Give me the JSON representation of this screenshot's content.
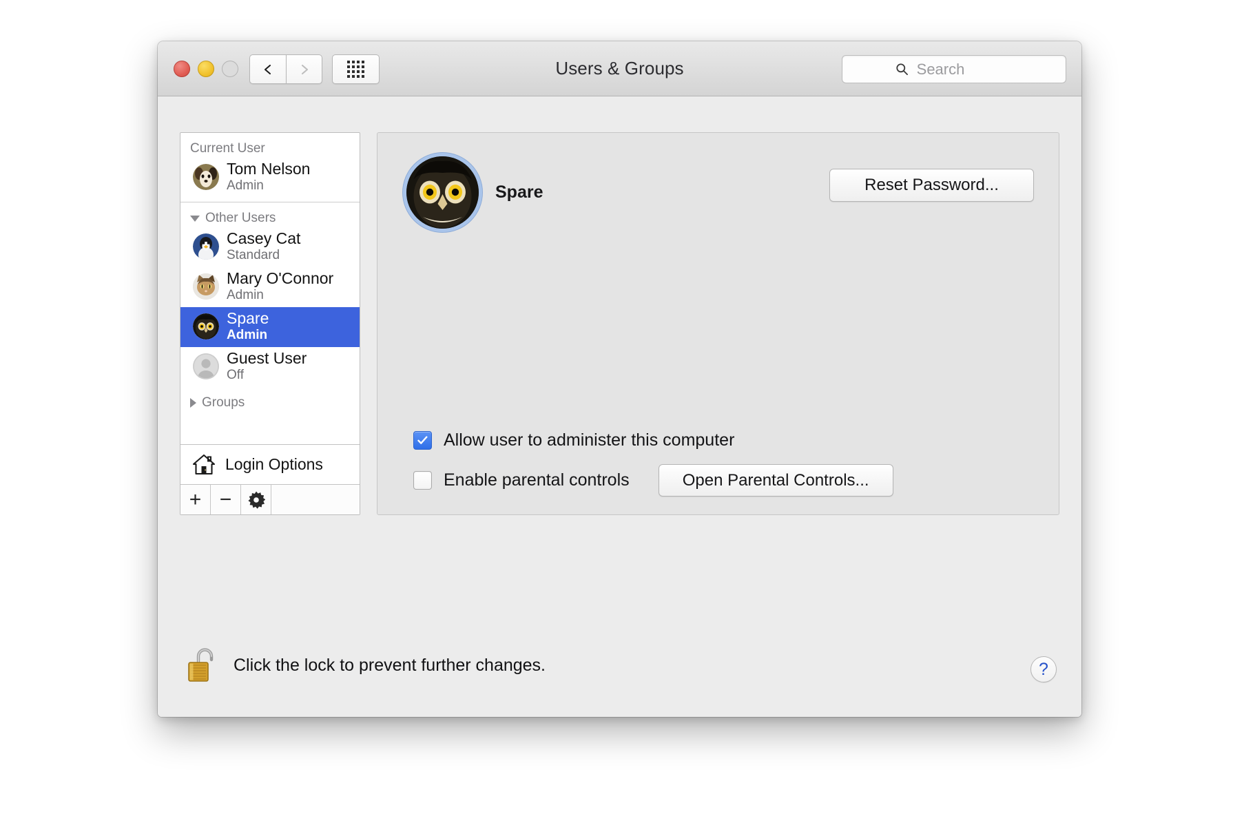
{
  "window": {
    "title": "Users & Groups",
    "traffic_lights": [
      "close",
      "minimize",
      "zoom"
    ],
    "nav": {
      "back": "back-arrow",
      "forward": "forward-arrow",
      "show_all": "grid-icon"
    },
    "search": {
      "placeholder": "Search",
      "value": "",
      "icon": "search-icon"
    }
  },
  "sidebar": {
    "groups": [
      {
        "label": "Current User",
        "collapsible": false
      },
      {
        "label": "Other Users",
        "collapsible": true,
        "expanded": true
      },
      {
        "label": "Groups",
        "collapsible": true,
        "expanded": false
      }
    ],
    "current_user": {
      "name": "Tom Nelson",
      "role": "Admin",
      "avatar": "dog-avatar"
    },
    "other_users": [
      {
        "name": "Casey Cat",
        "role": "Standard",
        "avatar": "penguin-avatar",
        "selected": false
      },
      {
        "name": "Mary O'Connor",
        "role": "Admin",
        "avatar": "cat-avatar",
        "selected": false
      },
      {
        "name": "Spare",
        "role": "Admin",
        "avatar": "owl-avatar",
        "selected": true
      },
      {
        "name": "Guest User",
        "role": "Off",
        "avatar": "person-placeholder-avatar",
        "selected": false
      }
    ],
    "login_options": {
      "label": "Login Options",
      "icon": "house-icon"
    },
    "toolbar": {
      "add_label": "+",
      "remove_label": "−",
      "settings_icon": "gear-icon"
    }
  },
  "detail": {
    "account_name": "Spare",
    "avatar": "owl-avatar",
    "reset_password_label": "Reset Password...",
    "checkboxes": [
      {
        "label": "Allow user to administer this computer",
        "checked": true
      },
      {
        "label": "Enable parental controls",
        "checked": false
      }
    ],
    "parental_button_label": "Open Parental Controls..."
  },
  "footer": {
    "lock_icon": "open-padlock-icon",
    "lock_message": "Click the lock to prevent further changes.",
    "help_label": "?"
  },
  "colors": {
    "selection_blue": "#3d63dd",
    "checkbox_blue": "#2f6fe8",
    "help_blue": "#2752c9",
    "window_bg": "#ececec",
    "panel_bg": "#e4e4e4"
  }
}
